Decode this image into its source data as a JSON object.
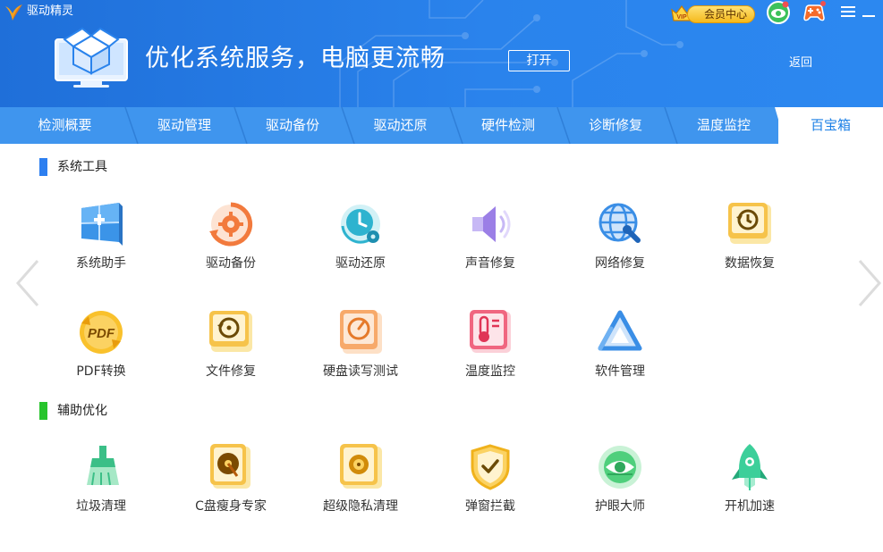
{
  "app": {
    "title": "驱动精灵"
  },
  "banner": {
    "text": "优化系统服务，电脑更流畅",
    "open_label": "打开",
    "back_label": "返回"
  },
  "topbar": {
    "vip_badge": "VIP",
    "vip_label": "会员中心"
  },
  "tabs": [
    {
      "label": "检测概要"
    },
    {
      "label": "驱动管理"
    },
    {
      "label": "驱动备份"
    },
    {
      "label": "驱动还原"
    },
    {
      "label": "硬件检测"
    },
    {
      "label": "诊断修复"
    },
    {
      "label": "温度监控"
    },
    {
      "label": "百宝箱",
      "active": true
    }
  ],
  "sections": [
    {
      "title": "系统工具",
      "color": "#2d7ff0",
      "tools": [
        {
          "label": "系统助手",
          "icon": "windows-icon"
        },
        {
          "label": "驱动备份",
          "icon": "backup-gear-icon"
        },
        {
          "label": "驱动还原",
          "icon": "restore-clock-icon"
        },
        {
          "label": "声音修复",
          "icon": "speaker-icon"
        },
        {
          "label": "网络修复",
          "icon": "network-globe-icon"
        },
        {
          "label": "数据恢复",
          "icon": "data-recovery-icon"
        },
        {
          "label": "PDF转换",
          "icon": "pdf-icon",
          "badge": "PDF"
        },
        {
          "label": "文件修复",
          "icon": "file-repair-icon"
        },
        {
          "label": "硬盘读写测试",
          "icon": "disk-speed-icon"
        },
        {
          "label": "温度监控",
          "icon": "thermometer-icon"
        },
        {
          "label": "软件管理",
          "icon": "software-triangle-icon"
        }
      ]
    },
    {
      "title": "辅助优化",
      "color": "#27c42c",
      "tools": [
        {
          "label": "垃圾清理",
          "icon": "broom-icon"
        },
        {
          "label": "C盘瘦身专家",
          "icon": "disk-slim-icon"
        },
        {
          "label": "超级隐私清理",
          "icon": "safe-icon"
        },
        {
          "label": "弹窗拦截",
          "icon": "shield-check-icon"
        },
        {
          "label": "护眼大师",
          "icon": "eye-icon"
        },
        {
          "label": "开机加速",
          "icon": "rocket-icon"
        }
      ]
    }
  ],
  "colors": {
    "header": "#2a83ec",
    "tabbar": "#3f95ee",
    "active_tab_text": "#1c80e6"
  }
}
